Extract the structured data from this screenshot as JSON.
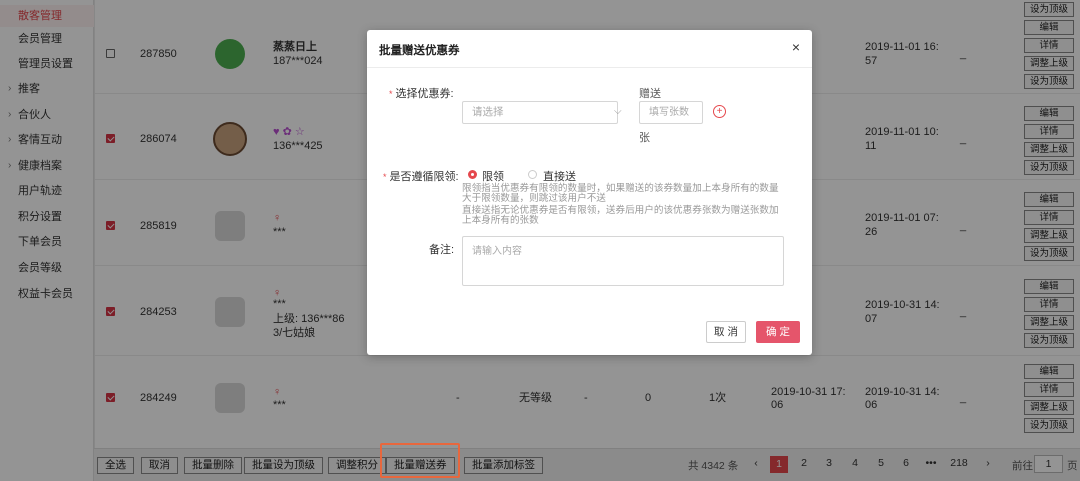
{
  "sidebar": {
    "items": [
      {
        "label": "散客管理",
        "active": true,
        "caret": false
      },
      {
        "label": "会员管理",
        "active": false,
        "caret": false
      },
      {
        "label": "管理员设置",
        "active": false,
        "caret": false
      },
      {
        "label": "推客",
        "active": false,
        "caret": true
      },
      {
        "label": "合伙人",
        "active": false,
        "caret": true
      },
      {
        "label": "客情互动",
        "active": false,
        "caret": true
      },
      {
        "label": "健康档案",
        "active": false,
        "caret": true
      },
      {
        "label": "用户轨迹",
        "active": false,
        "caret": false
      },
      {
        "label": "积分设置",
        "active": false,
        "caret": false
      },
      {
        "label": "下单会员",
        "active": false,
        "caret": false
      },
      {
        "label": "会员等级",
        "active": false,
        "caret": false
      },
      {
        "label": "权益卡会员",
        "active": false,
        "caret": false
      }
    ]
  },
  "table": {
    "rows": [
      {
        "checked": false,
        "id": "287850",
        "name": "蒸蒸日上",
        "phone": "187***024",
        "time1": "2019-11-01 16:",
        "time2": "57",
        "dash": "_"
      },
      {
        "checked": true,
        "id": "286074",
        "name": "",
        "phone": "136***425",
        "time1": "2019-11-01 10:",
        "time2": "11",
        "dash": "_"
      },
      {
        "checked": true,
        "id": "285819",
        "name": "",
        "phone": "***",
        "time1": "2019-11-01 07:",
        "time2": "26",
        "dash": "_"
      },
      {
        "checked": true,
        "id": "284253",
        "name": "",
        "phone": "***",
        "extra1": "上级: 136***86",
        "extra2": "3/七姑娘",
        "time1": "2019-10-31 14:",
        "time2": "07",
        "dash": "_"
      },
      {
        "checked": true,
        "id": "284249",
        "name": "",
        "phone": "***",
        "col_a": "-",
        "level": "无等级",
        "col_b": "-",
        "col_c": "0",
        "times": "1次",
        "created1": "2019-10-31 17:",
        "created2": "06",
        "time1": "2019-10-31 14:",
        "time2": "06",
        "dash": "_"
      }
    ],
    "actions": [
      "编辑",
      "详情",
      "调整上级",
      "设为顶级"
    ]
  },
  "bottom": {
    "buttons": [
      "全选",
      "取消",
      "批量删除",
      "批量设为顶级",
      "调整积分",
      "批量赠送券",
      "批量添加标签"
    ],
    "total": "共 4342 条",
    "pages": [
      "1",
      "2",
      "3",
      "4",
      "5",
      "6",
      "•••",
      "218"
    ],
    "prev": "‹",
    "next": "›",
    "goto_prefix": "前往",
    "goto_value": "1",
    "goto_suffix": "页"
  },
  "modal": {
    "title": "批量赠送优惠券",
    "close": "×",
    "coupon_label": "选择优惠券:",
    "coupon_placeholder": "请选择",
    "give_label": "赠送",
    "give_placeholder": "填写张数",
    "unit": "张",
    "limit_label": "是否遵循限领:",
    "option_limit": "限领",
    "option_direct": "直接送",
    "hint1": "限领指当优惠券有限领的数量时，如果赠送的该券数量加上本身所有的数量",
    "hint2": "大于限领数量，则跳过该用户不送",
    "hint3": "直接送指无论优惠券是否有限领，送券后用户的该优惠券张数为赠送张数加",
    "hint4": "上本身所有的张数",
    "remark_label": "备注:",
    "remark_placeholder": "请输入内容",
    "cancel": "取 消",
    "confirm": "确 定"
  },
  "colors": {
    "accent": "#e5484d",
    "highlight": "#e8673d"
  }
}
